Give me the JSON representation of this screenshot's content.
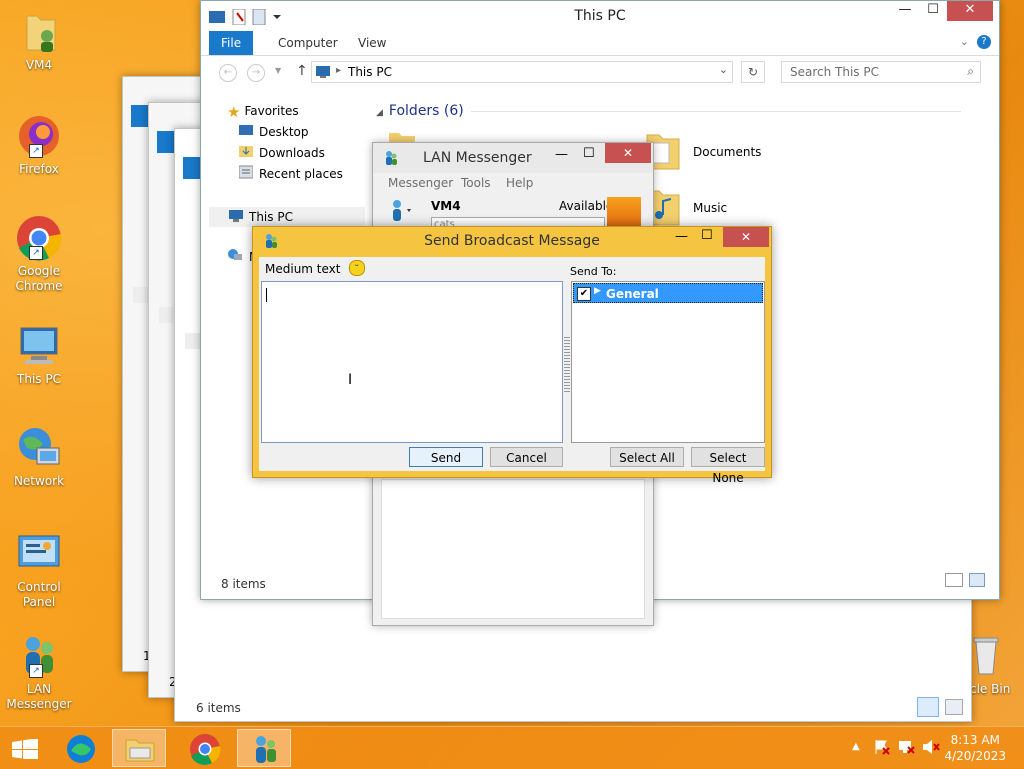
{
  "desktop": {
    "icons": [
      {
        "label": "VM4"
      },
      {
        "label": "Firefox"
      },
      {
        "label": "Google Chrome"
      },
      {
        "label": "This PC"
      },
      {
        "label": "Network"
      },
      {
        "label": "Control Panel"
      },
      {
        "label": "LAN Messenger"
      },
      {
        "label": "cle Bin"
      }
    ]
  },
  "explorer": {
    "title": "This PC",
    "tabs": [
      "File",
      "Computer",
      "View"
    ],
    "address": "This PC",
    "search_placeholder": "Search This PC",
    "nav": {
      "favorites": "Favorites",
      "desktop": "Desktop",
      "downloads": "Downloads",
      "recent": "Recent places",
      "this_pc": "This PC",
      "network_initial": "N"
    },
    "folders_header": "Folders (6)",
    "folders": [
      "Documents",
      "Music"
    ],
    "status": "8 items"
  },
  "back_explorer": {
    "status": "6 items",
    "side_digits": [
      "1",
      "2"
    ]
  },
  "lan": {
    "title": "LAN Messenger",
    "menu": [
      "Messenger",
      "Tools",
      "Help"
    ],
    "user": "VM4",
    "status": "Available",
    "note": "cats"
  },
  "broadcast": {
    "title": "Send Broadcast Message",
    "font_size": "Medium text",
    "send_to_label": "Send To:",
    "group": "General",
    "buttons": {
      "send": "Send",
      "cancel": "Cancel",
      "select_all": "Select All",
      "select_none": "Select None"
    }
  },
  "taskbar": {
    "time": "8:13 AM",
    "date": "4/20/2023"
  },
  "colors": {
    "accent": "#1979ca",
    "dialog": "#f5c542",
    "selected": "#3399ff",
    "close": "#c75050"
  }
}
